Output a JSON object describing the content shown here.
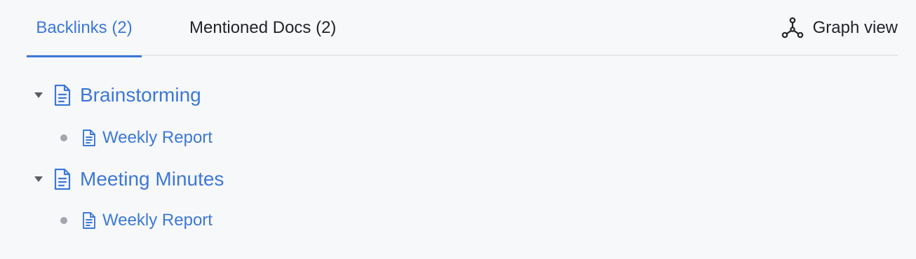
{
  "tabs": {
    "backlinks": "Backlinks (2)",
    "mentioned": "Mentioned Docs (2)"
  },
  "graph_view": {
    "label": "Graph view",
    "icon": "graph-icon"
  },
  "backlinks": [
    {
      "title": "Brainstorming",
      "icon": "document-icon",
      "expanded": true,
      "children": [
        {
          "title": "Weekly Report",
          "icon": "document-icon"
        }
      ]
    },
    {
      "title": "Meeting Minutes",
      "icon": "document-icon",
      "expanded": true,
      "children": [
        {
          "title": "Weekly Report",
          "icon": "document-icon"
        }
      ]
    }
  ],
  "colors": {
    "accent": "#3c78d8",
    "text": "#222428",
    "background": "#f7f8fa",
    "divider": "#e4e6ea",
    "bullet": "#a3a6ad"
  }
}
